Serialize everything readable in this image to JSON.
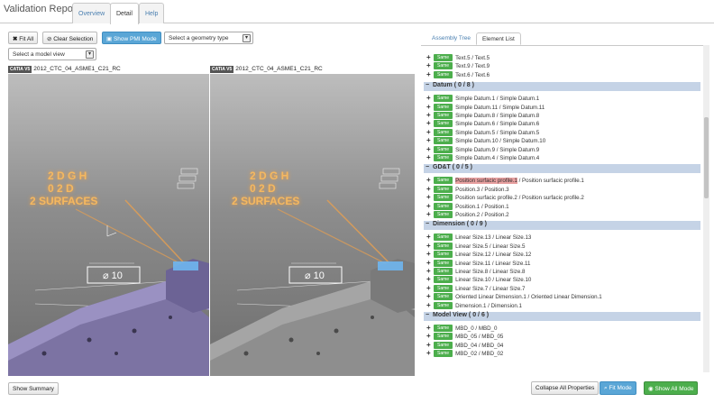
{
  "app": {
    "title": "Validation Report"
  },
  "tabs": [
    "Overview",
    "Detail",
    "Help"
  ],
  "toolbar": {
    "fit_all": "Fit All",
    "clear_selection": "Clear Selection",
    "show_pmi": "Show PMI Mode",
    "geometry_select": "Select a geometry type",
    "model_view_select": "Select a model view"
  },
  "viewers": [
    {
      "badge": "CATIA V5",
      "title": "2012_CTC_04_ASME1_C21_RC",
      "annotation": "⌀ 10",
      "fcf": [
        "2 D G H",
        "0 2 D",
        "2 SURFACES"
      ]
    },
    {
      "badge": "CATIA V5",
      "title": "2012_CTC_04_ASME1_C21_RC",
      "annotation": "⌀ 10",
      "fcf": [
        "2 D G H",
        "0 2 D",
        "2 SURFACES"
      ]
    }
  ],
  "right_tabs": [
    "Assembly Tree",
    "Element List"
  ],
  "same_label": "Same",
  "list": {
    "top": [
      "Text.5 / Text.5",
      "Text.9 / Text.9",
      "Text.6 / Text.6"
    ],
    "groups": [
      {
        "title": "Datum ( 0 / 8 )",
        "items": [
          "Simple Datum.1 / Simple Datum.1",
          "Simple Datum.11 / Simple Datum.11",
          "Simple Datum.8 / Simple Datum.8",
          "Simple Datum.6 / Simple Datum.6",
          "Simple Datum.5 / Simple Datum.5",
          "Simple Datum.10 / Simple Datum.10",
          "Simple Datum.9 / Simple Datum.9",
          "Simple Datum.4 / Simple Datum.4"
        ]
      },
      {
        "title": "GD&T ( 0 / 5 )",
        "items": [
          [
            "Position surfacic profile.1",
            " / Position surfacic profile.1"
          ],
          "Position.3 / Position.3",
          "Position surfacic profile.2 / Position surfacic profile.2",
          "Position.1 / Position.1",
          "Position.2 / Position.2"
        ]
      },
      {
        "title": "Dimension ( 0 / 9 )",
        "items": [
          "Linear Size.13 / Linear Size.13",
          "Linear Size.5 / Linear Size.5",
          "Linear Size.12 / Linear Size.12",
          "Linear Size.11 / Linear Size.11",
          "Linear Size.8 / Linear Size.8",
          "Linear Size.10 / Linear Size.10",
          "Linear Size.7 / Linear Size.7",
          "Oriented Linear Dimension.1 / Oriented Linear Dimension.1",
          "Dimension.1 / Dimension.1"
        ]
      },
      {
        "title": "Model View ( 0 / 6 )",
        "items": [
          "MBD_0 / MBD_0",
          "MBD_05 / MBD_05",
          "MBD_04 / MBD_04",
          "MBD_02 / MBD_02"
        ]
      }
    ]
  },
  "bottom": {
    "show_summary": "Show Summary",
    "collapse_all": "Collapse All Properties",
    "fit_mode": "Fit Mode",
    "show_all": "Show All Mode"
  }
}
